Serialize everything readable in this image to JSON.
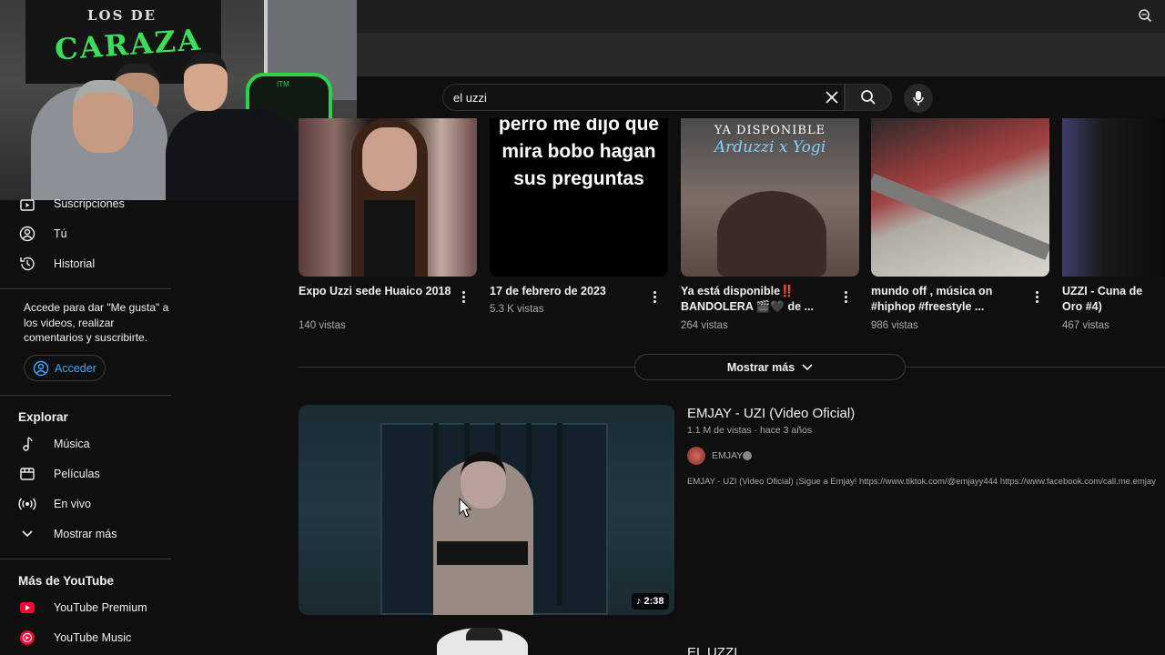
{
  "search": {
    "query": "el uzzi"
  },
  "webcam": {
    "banner_line1": "LOS DE",
    "banner_line2": "CARAZA",
    "chair_logo": "ITM"
  },
  "sidebar": {
    "items_top": [
      {
        "label": "Suscripciones",
        "icon": "subscriptions-icon"
      },
      {
        "label": "Tú",
        "icon": "user-icon"
      },
      {
        "label": "Historial",
        "icon": "history-icon"
      }
    ],
    "signin_text": "Accede para dar \"Me gusta\" a los videos, realizar comentarios y suscribirte.",
    "signin_button": "Acceder",
    "explore_heading": "Explorar",
    "explore_items": [
      {
        "label": "Música",
        "icon": "music-icon"
      },
      {
        "label": "Películas",
        "icon": "film-icon"
      },
      {
        "label": "En vivo",
        "icon": "live-icon"
      },
      {
        "label": "Mostrar más",
        "icon": "chevron-down-icon"
      }
    ],
    "more_heading": "Más de YouTube",
    "more_items": [
      {
        "label": "YouTube Premium",
        "icon": "youtube-premium-icon",
        "color": "#ff0033"
      },
      {
        "label": "YouTube Music",
        "icon": "youtube-music-icon",
        "color": "#ff0033"
      }
    ]
  },
  "shorts": [
    {
      "title": "Expo Uzzi sede Huaico 2018",
      "views": "140 vistas"
    },
    {
      "title": "17 de febrero de 2023",
      "views": "5.3 K vistas",
      "thumb_text": "perro me dijo que mira bobo hagan sus preguntas"
    },
    {
      "title": "Ya está disponible‼️ BANDOLERA 🎬🖤 de ...",
      "views": "264 vistas",
      "thumb_line1": "YA DISPONIBLE",
      "thumb_line2": "Arduzzi x Yogi"
    },
    {
      "title": "mundo off , música on #hiphop #freestyle ...",
      "views": "986 vistas"
    },
    {
      "title": "UZZI - Cuna de Oro #4)",
      "views": "467 vistas"
    }
  ],
  "show_more": "Mostrar más",
  "video": {
    "title": "EMJAY - UZI (Video Oficial)",
    "meta": "1.1 M de vistas · hace 3 años",
    "channel": "EMJAY",
    "description": "EMJAY - UZI (Video Oficial) ¡Sigue a Emjay! https://www.tiktok.com/@emjayy444 https://www.facebook.com/call.me.emjay",
    "duration": "2:38"
  },
  "next_video": {
    "title": "EL UZZI"
  }
}
